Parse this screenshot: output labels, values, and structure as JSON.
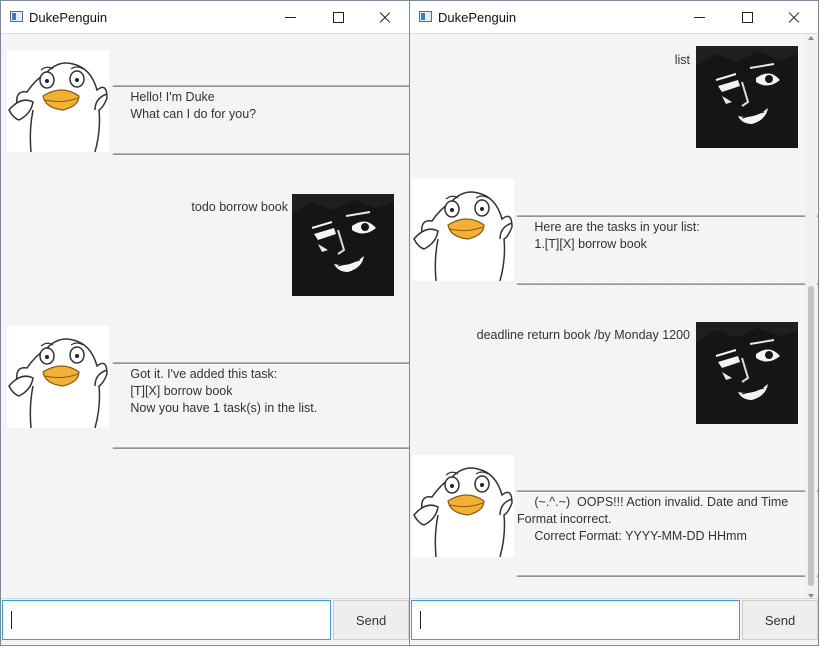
{
  "app_title": "DukePenguin",
  "send_label": "Send",
  "left": {
    "messages": [
      "________________________________________________\n     Hello! I'm Duke\n     What can I do for you?\n\n________________________________________________",
      "todo borrow book",
      "________________________________________________\n     Got it. I've added this task:\n     [T][X] borrow book\n     Now you have 1 task(s) in the list.\n\n________________________________________________"
    ]
  },
  "right": {
    "messages": [
      "list",
      "________________________________________________\n     Here are the tasks in your list:\n     1.[T][X] borrow book\n\n________________________________________________",
      "deadline return book /by Monday 1200",
      "________________________________________________\n     (~.^.~)  OOPS!!! Action invalid. Date and Time\nFormat incorrect.\n     Correct Format: YYYY-MM-DD HHmm\n\n________________________________________________"
    ]
  }
}
